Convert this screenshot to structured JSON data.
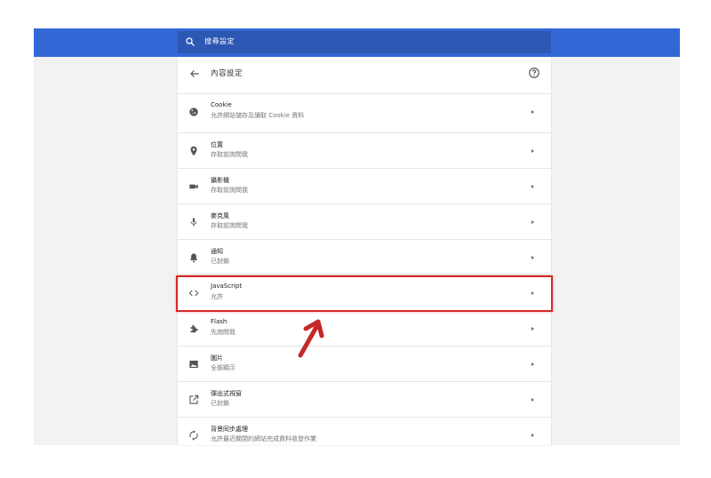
{
  "search": {
    "placeholder": "搜尋設定",
    "icon": "search-icon"
  },
  "header": {
    "title": "內容設定",
    "back_icon": "arrow-left-icon",
    "help_icon": "help-circle-icon"
  },
  "rows": [
    {
      "title": "Cookie",
      "subtitle": "允許網站儲存及讀取 Cookie 資料",
      "icon": "cookie-icon"
    },
    {
      "title": "位置",
      "subtitle": "存取前詢問我",
      "icon": "location-pin-icon"
    },
    {
      "title": "攝影機",
      "subtitle": "存取前詢問我",
      "icon": "camera-icon"
    },
    {
      "title": "麥克風",
      "subtitle": "存取前詢問我",
      "icon": "microphone-icon"
    },
    {
      "title": "通知",
      "subtitle": "已封鎖",
      "icon": "bell-icon"
    },
    {
      "title": "JavaScript",
      "subtitle": "允許",
      "icon": "code-icon"
    },
    {
      "title": "Flash",
      "subtitle": "先詢問我",
      "icon": "puzzle-icon"
    },
    {
      "title": "圖片",
      "subtitle": "全部顯示",
      "icon": "image-icon"
    },
    {
      "title": "彈出式視窗",
      "subtitle": "已封鎖",
      "icon": "open-in-new-icon"
    },
    {
      "title": "背景同步處理",
      "subtitle": "允許最近關閉的網站完成資料收發作業",
      "icon": "sync-icon"
    }
  ],
  "colors": {
    "topbar": "#3367d6",
    "highlight": "#d62828",
    "background": "#f2f2f2"
  }
}
